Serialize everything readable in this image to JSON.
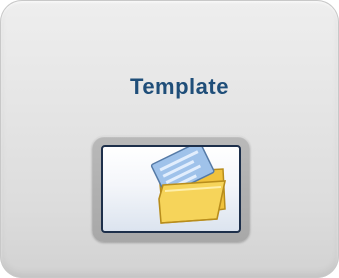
{
  "panel": {
    "title": "Template"
  },
  "icon": {
    "name": "open-template-folder-icon",
    "colors": {
      "accent_title": "#1f4e79",
      "button_border": "#1d2f4a",
      "folder_yellow": "#f3c63b",
      "document_blue": "#8fb2dd"
    }
  }
}
